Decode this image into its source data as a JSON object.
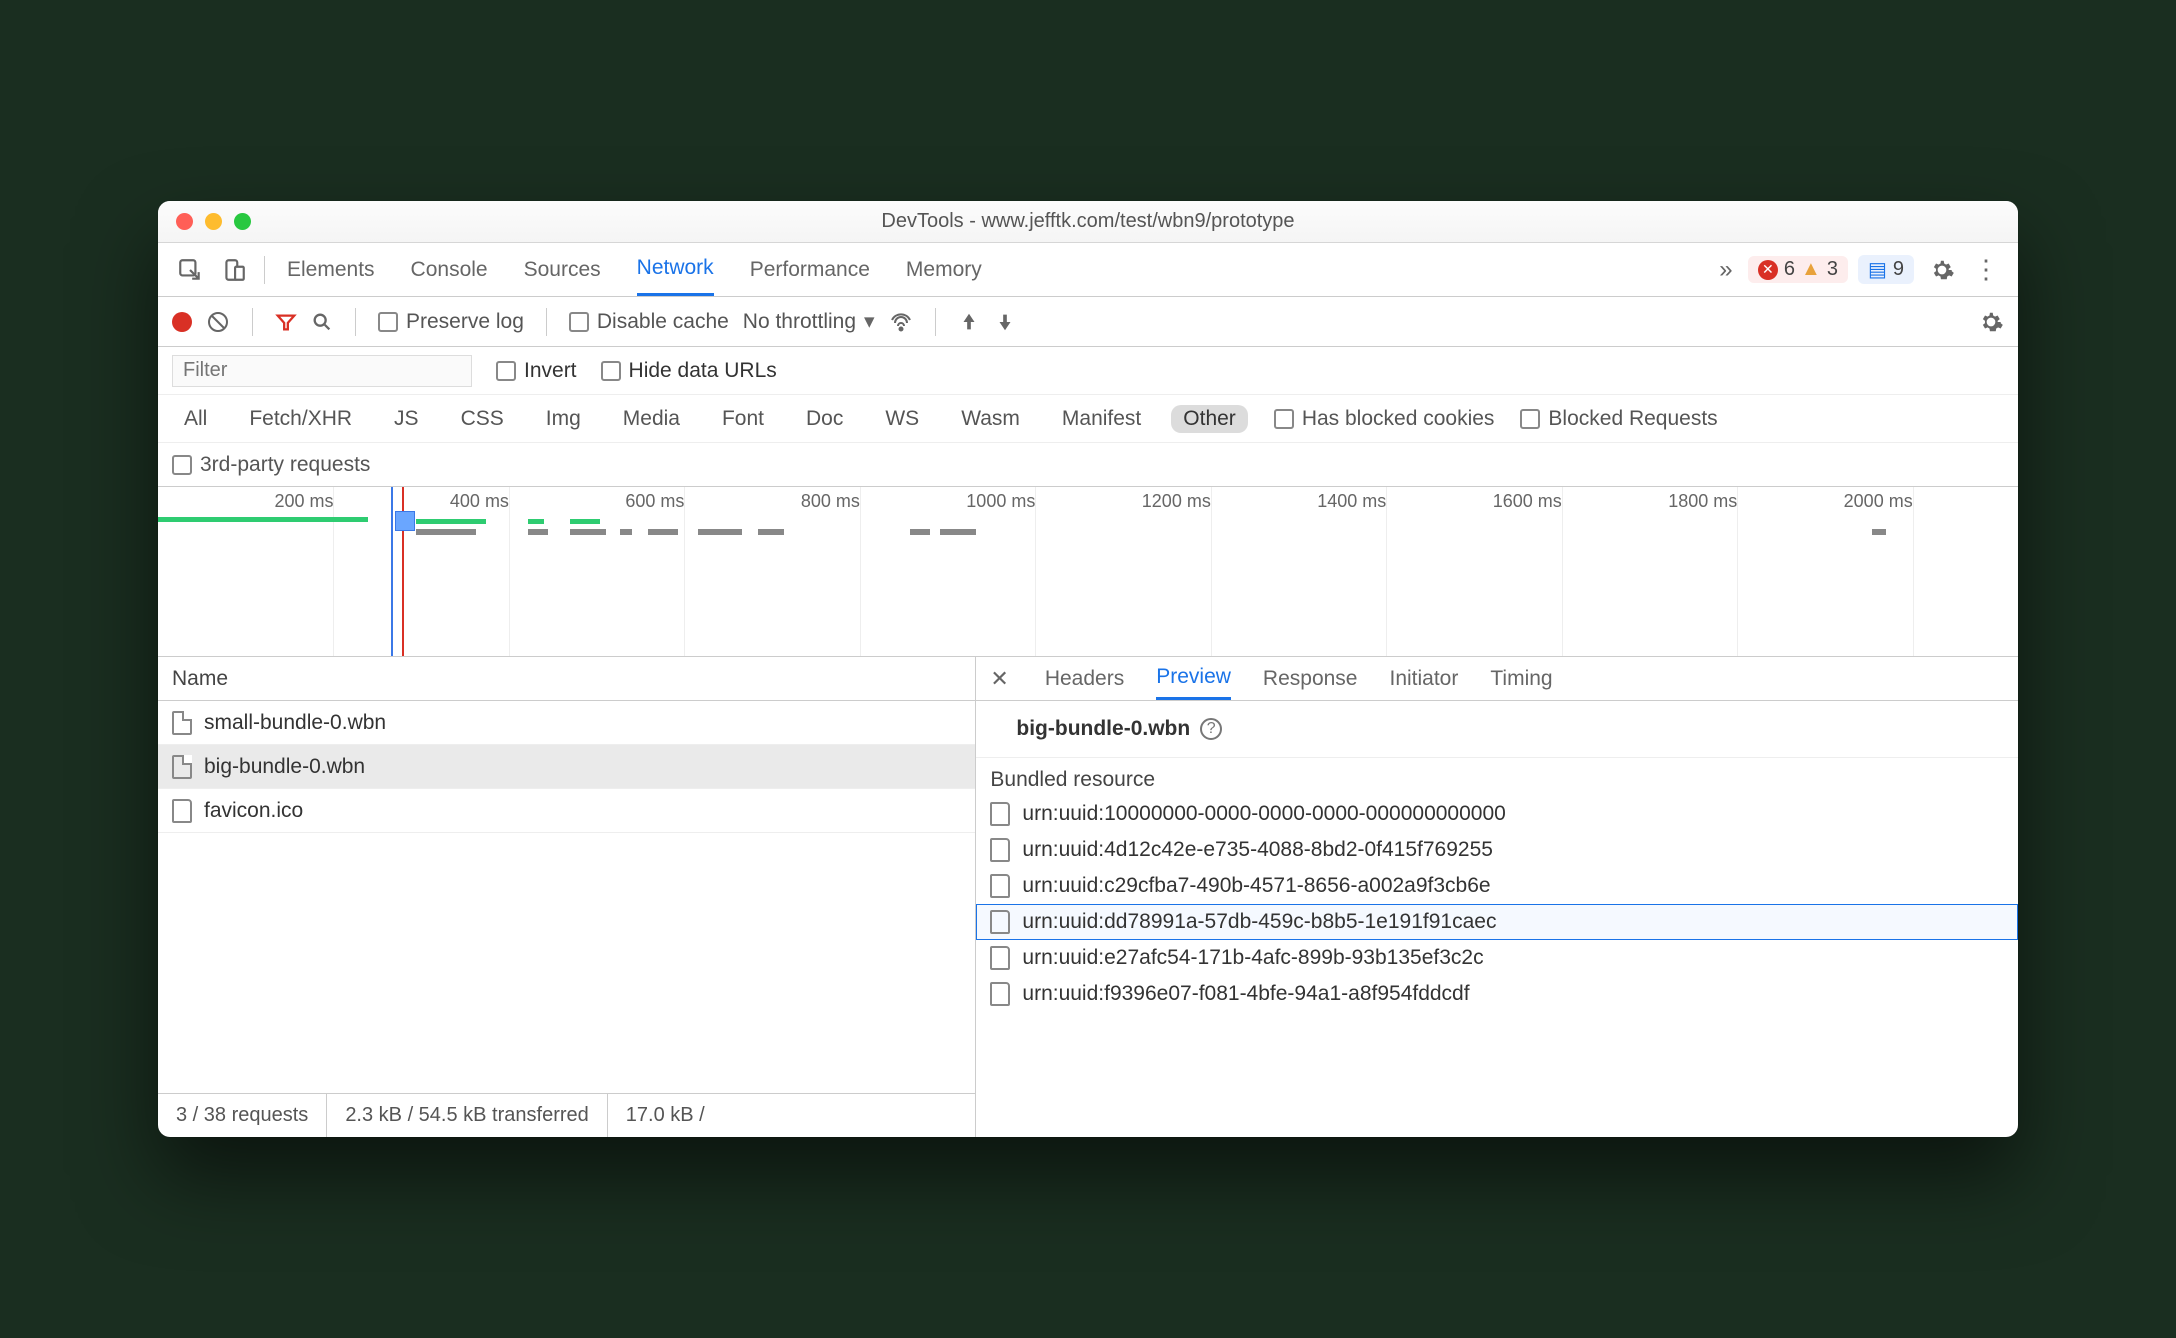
{
  "titlebar": {
    "title": "DevTools - www.jefftk.com/test/wbn9/prototype"
  },
  "mainTabs": {
    "items": [
      "Elements",
      "Console",
      "Sources",
      "Network",
      "Performance",
      "Memory"
    ],
    "activeIndex": 3,
    "overflowGlyph": "»"
  },
  "counters": {
    "errors": "6",
    "warnings": "3",
    "messages": "9"
  },
  "toolbar": {
    "preserve_log": "Preserve log",
    "disable_cache": "Disable cache",
    "throttling": "No throttling"
  },
  "filter": {
    "placeholder": "Filter",
    "invert": "Invert",
    "hide_data_urls": "Hide data URLs"
  },
  "types": {
    "items": [
      "All",
      "Fetch/XHR",
      "JS",
      "CSS",
      "Img",
      "Media",
      "Font",
      "Doc",
      "WS",
      "Wasm",
      "Manifest",
      "Other"
    ],
    "activeIndex": 11,
    "blocked_cookies": "Has blocked cookies",
    "blocked_requests": "Blocked Requests",
    "third_party": "3rd-party requests"
  },
  "timeline": {
    "ticks": [
      "200 ms",
      "400 ms",
      "600 ms",
      "800 ms",
      "1000 ms",
      "1200 ms",
      "1400 ms",
      "1600 ms",
      "1800 ms",
      "2000 ms"
    ]
  },
  "requests": {
    "header": "Name",
    "items": [
      {
        "name": "small-bundle-0.wbn"
      },
      {
        "name": "big-bundle-0.wbn"
      },
      {
        "name": "favicon.ico"
      }
    ],
    "selectedIndex": 1
  },
  "status": {
    "requests": "3 / 38 requests",
    "transferred": "2.3 kB / 54.5 kB transferred",
    "resources": "17.0 kB /"
  },
  "detail": {
    "tabs": [
      "Headers",
      "Preview",
      "Response",
      "Initiator",
      "Timing"
    ],
    "activeIndex": 1,
    "title": "big-bundle-0.wbn",
    "section": "Bundled resource",
    "resources": [
      "urn:uuid:10000000-0000-0000-0000-000000000000",
      "urn:uuid:4d12c42e-e735-4088-8bd2-0f415f769255",
      "urn:uuid:c29cfba7-490b-4571-8656-a002a9f3cb6e",
      "urn:uuid:dd78991a-57db-459c-b8b5-1e191f91caec",
      "urn:uuid:e27afc54-171b-4afc-899b-93b135ef3c2c",
      "urn:uuid:f9396e07-f081-4bfe-94a1-a8f954fddcdf"
    ],
    "selectedResourceIndex": 3
  }
}
